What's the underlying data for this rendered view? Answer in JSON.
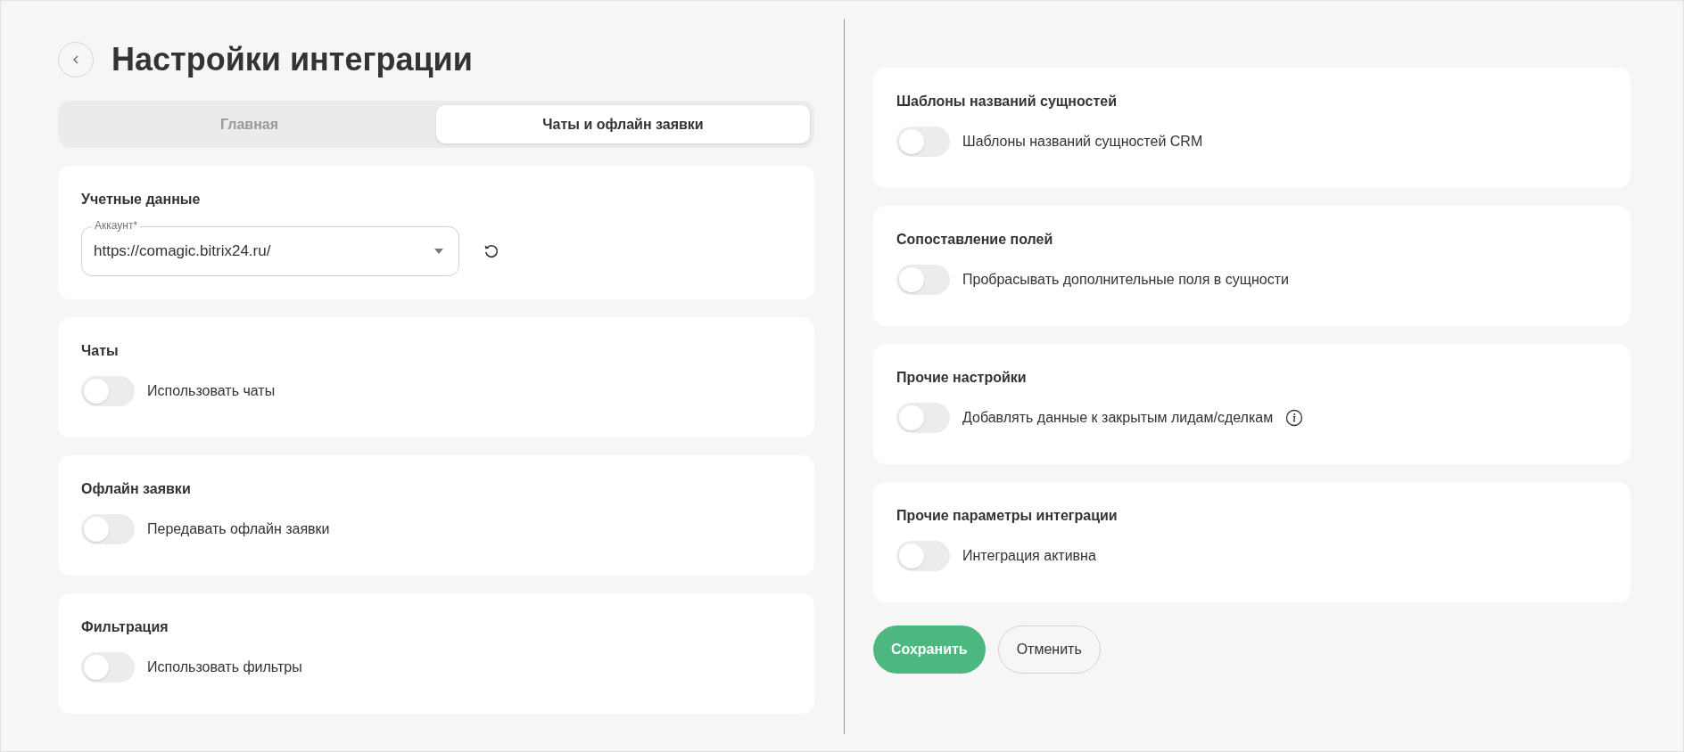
{
  "title": "Настройки интеграции",
  "tabs": [
    {
      "label": "Главная",
      "selected": false
    },
    {
      "label": "Чаты и офлайн заявки",
      "selected": true
    }
  ],
  "left_cards": [
    {
      "kind": "select",
      "heading": "Учетные данные",
      "field": {
        "label": "Аккаунт*",
        "value": "https://comagic.bitrix24.ru/"
      }
    },
    {
      "kind": "toggle",
      "heading": "Чаты",
      "toggle": {
        "label": "Использовать чаты",
        "on": false,
        "info": false
      }
    },
    {
      "kind": "toggle",
      "heading": "Офлайн заявки",
      "toggle": {
        "label": "Передавать офлайн заявки",
        "on": false,
        "info": false
      }
    },
    {
      "kind": "toggle",
      "heading": "Фильтрация",
      "toggle": {
        "label": "Использовать фильтры",
        "on": false,
        "info": false
      }
    }
  ],
  "right_cards": [
    {
      "kind": "toggle",
      "heading": "Шаблоны названий сущностей",
      "toggle": {
        "label": "Шаблоны названий сущностей CRM",
        "on": false,
        "info": false
      }
    },
    {
      "kind": "toggle",
      "heading": "Сопоставление полей",
      "toggle": {
        "label": "Пробрасывать дополнительные поля в сущности",
        "on": false,
        "info": false
      }
    },
    {
      "kind": "toggle",
      "heading": "Прочие настройки",
      "toggle": {
        "label": "Добавлять данные к закрытым лидам/сделкам",
        "on": false,
        "info": true
      }
    },
    {
      "kind": "toggle",
      "heading": "Прочие параметры интеграции",
      "toggle": {
        "label": "Интеграция активна",
        "on": false,
        "info": false
      }
    }
  ],
  "buttons": [
    {
      "label": "Сохранить",
      "kind": "primary"
    },
    {
      "label": "Отменить",
      "kind": "secondary"
    }
  ]
}
